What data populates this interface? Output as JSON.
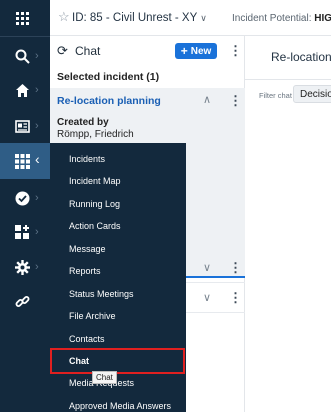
{
  "rail": {
    "items": [
      {
        "name": "apps-grid-icon"
      },
      {
        "name": "search-icon"
      },
      {
        "name": "home-icon"
      },
      {
        "name": "newspaper-icon"
      },
      {
        "name": "modules-grid-icon"
      },
      {
        "name": "check-circle-icon"
      },
      {
        "name": "add-widget-icon"
      },
      {
        "name": "settings-gear-icon"
      },
      {
        "name": "link-icon"
      }
    ]
  },
  "header": {
    "incident_title": "ID: 85 - Civil Unrest - XY",
    "potential_label": "Incident Potential:",
    "potential_value": "HIGH"
  },
  "chat_panel": {
    "title": "Chat",
    "new_label": "New",
    "selected_incident": "Selected incident (1)",
    "chat_item": {
      "title": "Re-location planning",
      "created_by_label": "Created by",
      "created_by_name": "Römpp, Friedrich"
    }
  },
  "right_panel": {
    "title": "Re-location p",
    "filter_label": "Filter chat",
    "filter_value": "Decision"
  },
  "flyout_menu": {
    "items": [
      {
        "label": "Incidents"
      },
      {
        "label": "Incident Map"
      },
      {
        "label": "Running Log"
      },
      {
        "label": "Action Cards"
      },
      {
        "label": "Message"
      },
      {
        "label": "Reports"
      },
      {
        "label": "Status Meetings"
      },
      {
        "label": "File Archive"
      },
      {
        "label": "Contacts"
      },
      {
        "label": "Chat"
      },
      {
        "label": "Media Requests"
      },
      {
        "label": "Approved Media Answers"
      }
    ],
    "active": "Chat"
  },
  "tooltip": "Chat",
  "colors": {
    "rail_bg": "#13293d",
    "accent": "#1a72d9",
    "highlight_border": "#e02020"
  }
}
